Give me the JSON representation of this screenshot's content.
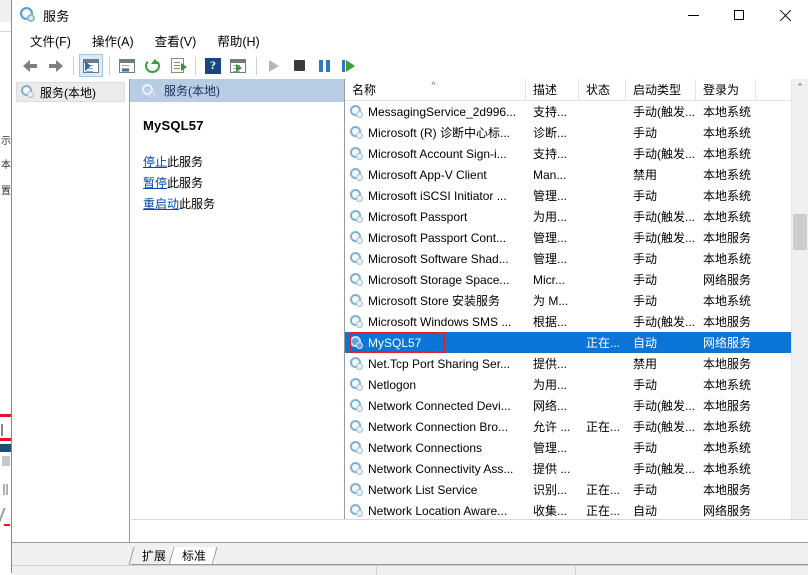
{
  "window": {
    "title": "服务",
    "icon": "gear-icon",
    "controls": {
      "minimize": "—",
      "maximize": "□",
      "close": "✕"
    }
  },
  "menubar": {
    "items": [
      {
        "label": "文件(F)",
        "name": "menu-file"
      },
      {
        "label": "操作(A)",
        "name": "menu-action"
      },
      {
        "label": "查看(V)",
        "name": "menu-view"
      },
      {
        "label": "帮助(H)",
        "name": "menu-help"
      }
    ]
  },
  "toolbar": {
    "buttons": [
      {
        "name": "back-button",
        "icon": "arrow-left-icon"
      },
      {
        "name": "forward-button",
        "icon": "arrow-right-icon"
      },
      {
        "name": "show-hide-tree-button",
        "icon": "console-tree-icon"
      },
      {
        "name": "properties-button",
        "icon": "properties-window-icon"
      },
      {
        "name": "refresh-button",
        "icon": "refresh-icon"
      },
      {
        "name": "export-list-button",
        "icon": "export-list-icon"
      },
      {
        "name": "help-button",
        "icon": "help-question-icon"
      },
      {
        "name": "show-action-pane-button",
        "icon": "action-pane-icon"
      },
      {
        "name": "start-service-button",
        "icon": "play-icon"
      },
      {
        "name": "stop-service-button",
        "icon": "stop-icon"
      },
      {
        "name": "pause-service-button",
        "icon": "pause-icon"
      },
      {
        "name": "restart-service-button",
        "icon": "restart-icon"
      }
    ]
  },
  "tree": {
    "items": [
      {
        "label": "服务(本地)",
        "name": "tree-item-services-local",
        "icon": "gear-icon"
      }
    ]
  },
  "detail": {
    "header": "服务(本地)",
    "service_name": "MySQL57",
    "links": [
      {
        "link": "停止",
        "suffix": "此服务",
        "name": "stop-service-link"
      },
      {
        "link": "暂停",
        "suffix": "此服务",
        "name": "pause-service-link"
      },
      {
        "link": "重启动",
        "suffix": "此服务",
        "name": "restart-service-link"
      }
    ]
  },
  "list": {
    "columns": [
      {
        "label": "名称",
        "key": "name",
        "sorted": "asc",
        "sortmark": "^"
      },
      {
        "label": "描述",
        "key": "desc"
      },
      {
        "label": "状态",
        "key": "status"
      },
      {
        "label": "启动类型",
        "key": "startup"
      },
      {
        "label": "登录为",
        "key": "logon"
      }
    ],
    "selected_index": 11,
    "annotation": {
      "type": "red-rectangle",
      "color": "#ee1c25",
      "target": "MySQL57"
    },
    "rows": [
      {
        "name": "MessagingService_2d996...",
        "desc": "支持...",
        "status": "",
        "startup": "手动(触发...",
        "logon": "本地系统"
      },
      {
        "name": "Microsoft (R) 诊断中心标...",
        "desc": "诊断...",
        "status": "",
        "startup": "手动",
        "logon": "本地系统"
      },
      {
        "name": "Microsoft Account Sign-i...",
        "desc": "支持...",
        "status": "",
        "startup": "手动(触发...",
        "logon": "本地系统"
      },
      {
        "name": "Microsoft App-V Client",
        "desc": "Man...",
        "status": "",
        "startup": "禁用",
        "logon": "本地系统"
      },
      {
        "name": "Microsoft iSCSI Initiator ...",
        "desc": "管理...",
        "status": "",
        "startup": "手动",
        "logon": "本地系统"
      },
      {
        "name": "Microsoft Passport",
        "desc": "为用...",
        "status": "",
        "startup": "手动(触发...",
        "logon": "本地系统"
      },
      {
        "name": "Microsoft Passport Cont...",
        "desc": "管理...",
        "status": "",
        "startup": "手动(触发...",
        "logon": "本地服务"
      },
      {
        "name": "Microsoft Software Shad...",
        "desc": "管理...",
        "status": "",
        "startup": "手动",
        "logon": "本地系统"
      },
      {
        "name": "Microsoft Storage Space...",
        "desc": "Micr...",
        "status": "",
        "startup": "手动",
        "logon": "网络服务"
      },
      {
        "name": "Microsoft Store 安装服务",
        "desc": "为 M...",
        "status": "",
        "startup": "手动",
        "logon": "本地系统"
      },
      {
        "name": "Microsoft Windows SMS ...",
        "desc": "根据...",
        "status": "",
        "startup": "手动(触发...",
        "logon": "本地服务"
      },
      {
        "name": "MySQL57",
        "desc": "",
        "status": "正在...",
        "startup": "自动",
        "logon": "网络服务"
      },
      {
        "name": "Net.Tcp Port Sharing Ser...",
        "desc": "提供...",
        "status": "",
        "startup": "禁用",
        "logon": "本地服务"
      },
      {
        "name": "Netlogon",
        "desc": "为用...",
        "status": "",
        "startup": "手动",
        "logon": "本地系统"
      },
      {
        "name": "Network Connected Devi...",
        "desc": "网络...",
        "status": "",
        "startup": "手动(触发...",
        "logon": "本地服务"
      },
      {
        "name": "Network Connection Bro...",
        "desc": "允许 ...",
        "status": "正在...",
        "startup": "手动(触发...",
        "logon": "本地系统"
      },
      {
        "name": "Network Connections",
        "desc": "管理...",
        "status": "",
        "startup": "手动",
        "logon": "本地系统"
      },
      {
        "name": "Network Connectivity Ass...",
        "desc": "提供 ...",
        "status": "",
        "startup": "手动(触发...",
        "logon": "本地系统"
      },
      {
        "name": "Network List Service",
        "desc": "识别...",
        "status": "正在...",
        "startup": "手动",
        "logon": "本地服务"
      },
      {
        "name": "Network Location Aware...",
        "desc": "收集...",
        "status": "正在...",
        "startup": "自动",
        "logon": "网络服务"
      }
    ]
  },
  "scrollbar": {
    "up_arrow": "⌃",
    "down_arrow": "⌄"
  },
  "tabs": {
    "items": [
      {
        "label": "扩展",
        "name": "tab-extended",
        "active": false
      },
      {
        "label": "标准",
        "name": "tab-standard",
        "active": true
      }
    ]
  }
}
